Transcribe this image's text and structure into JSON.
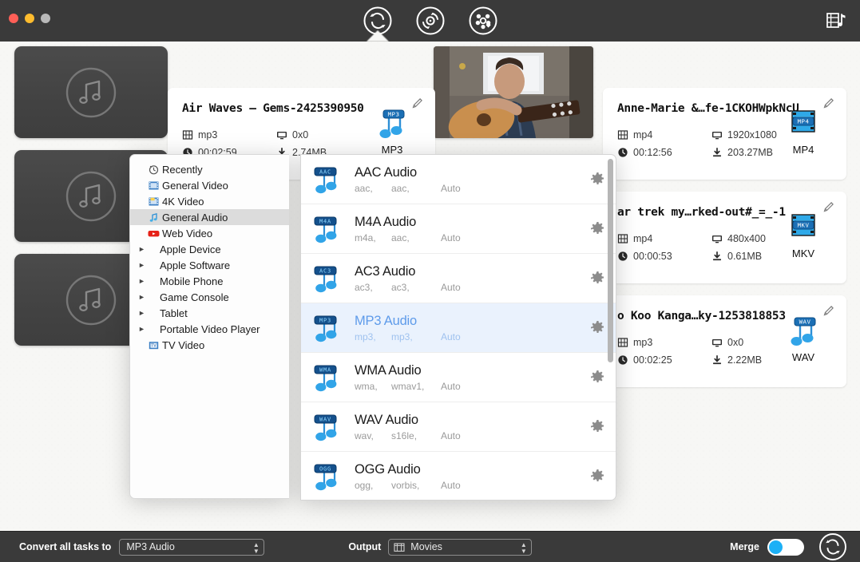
{
  "window": {
    "traffic_lights": [
      "close",
      "minimize",
      "zoom"
    ],
    "toolbar_icons": [
      {
        "name": "converter-icon",
        "title": "Converter"
      },
      {
        "name": "ripper-icon",
        "title": "Ripper"
      },
      {
        "name": "downloader-icon",
        "title": "Downloader"
      }
    ],
    "toolbar_right_icon": {
      "name": "media-library-icon",
      "title": "Media Library"
    }
  },
  "files": [
    {
      "title": "Air Waves — Gems-2425390950",
      "codec": "mp3",
      "resolution": "0x0",
      "duration": "00:02:59",
      "size": "2.74MB",
      "target_format": "MP3",
      "thumb_type": "audio"
    },
    {
      "title": "Anne-Marie &…fe-1CKOHWpkNcU",
      "codec": "mp4",
      "resolution": "1920x1080",
      "duration": "00:12:56",
      "size": "203.27MB",
      "target_format": "MP4",
      "thumb_type": "video"
    },
    {
      "title": "ar trek my…rked-out#_=_-1",
      "codec": "mp4",
      "resolution": "480x400",
      "duration": "00:00:53",
      "size": "0.61MB",
      "target_format": "MKV",
      "thumb_type": "audio"
    },
    {
      "title": "o Koo Kanga…ky-1253818853",
      "codec": "mp3",
      "resolution": "0x0",
      "duration": "00:02:25",
      "size": "2.22MB",
      "target_format": "WAV",
      "thumb_type": "audio"
    }
  ],
  "popover": {
    "categories": [
      {
        "label": "Recently",
        "icon": "clock-icon",
        "selected": false,
        "expandable": false
      },
      {
        "label": "General Video",
        "icon": "video-icon",
        "selected": false,
        "expandable": false
      },
      {
        "label": "4K Video",
        "icon": "4k-video-icon",
        "selected": false,
        "expandable": false
      },
      {
        "label": "General Audio",
        "icon": "audio-icon",
        "selected": true,
        "expandable": false
      },
      {
        "label": "Web Video",
        "icon": "youtube-icon",
        "selected": false,
        "expandable": false
      },
      {
        "label": "Apple Device",
        "icon": "",
        "selected": false,
        "expandable": true
      },
      {
        "label": "Apple Software",
        "icon": "",
        "selected": false,
        "expandable": true
      },
      {
        "label": "Mobile Phone",
        "icon": "",
        "selected": false,
        "expandable": true
      },
      {
        "label": "Game Console",
        "icon": "",
        "selected": false,
        "expandable": true
      },
      {
        "label": "Tablet",
        "icon": "",
        "selected": false,
        "expandable": true
      },
      {
        "label": "Portable Video Player",
        "icon": "",
        "selected": false,
        "expandable": true
      },
      {
        "label": "TV Video",
        "icon": "tv-icon",
        "selected": false,
        "expandable": false
      }
    ],
    "formats": [
      {
        "name": "AAC Audio",
        "badge": "AAC",
        "container": "aac,",
        "codec": "aac,",
        "quality": "Auto",
        "selected": false
      },
      {
        "name": "M4A Audio",
        "badge": "M4A",
        "container": "m4a,",
        "codec": "aac,",
        "quality": "Auto",
        "selected": false
      },
      {
        "name": "AC3 Audio",
        "badge": "AC3",
        "container": "ac3,",
        "codec": "ac3,",
        "quality": "Auto",
        "selected": false
      },
      {
        "name": "MP3 Audio",
        "badge": "MP3",
        "container": "mp3,",
        "codec": "mp3,",
        "quality": "Auto",
        "selected": true
      },
      {
        "name": "WMA Audio",
        "badge": "WMA",
        "container": "wma,",
        "codec": "wmav1,",
        "quality": "Auto",
        "selected": false
      },
      {
        "name": "WAV Audio",
        "badge": "WAV",
        "container": "wav,",
        "codec": "s16le,",
        "quality": "Auto",
        "selected": false
      },
      {
        "name": "OGG Audio",
        "badge": "OGG",
        "container": "ogg,",
        "codec": "vorbis,",
        "quality": "Auto",
        "selected": false
      }
    ]
  },
  "bottom": {
    "convert_all_label": "Convert all tasks to",
    "convert_all_value": "MP3 Audio",
    "output_label": "Output",
    "output_value": "Movies",
    "merge_label": "Merge",
    "merge_on": false,
    "convert_button": "convert-start-button"
  },
  "colors": {
    "chrome": "#3a3a3a",
    "canvas": "#f7f7f5",
    "accent_blue": "#1cb0f6",
    "selected_row": "#eaf2fd",
    "selected_text": "#5e9bea"
  }
}
